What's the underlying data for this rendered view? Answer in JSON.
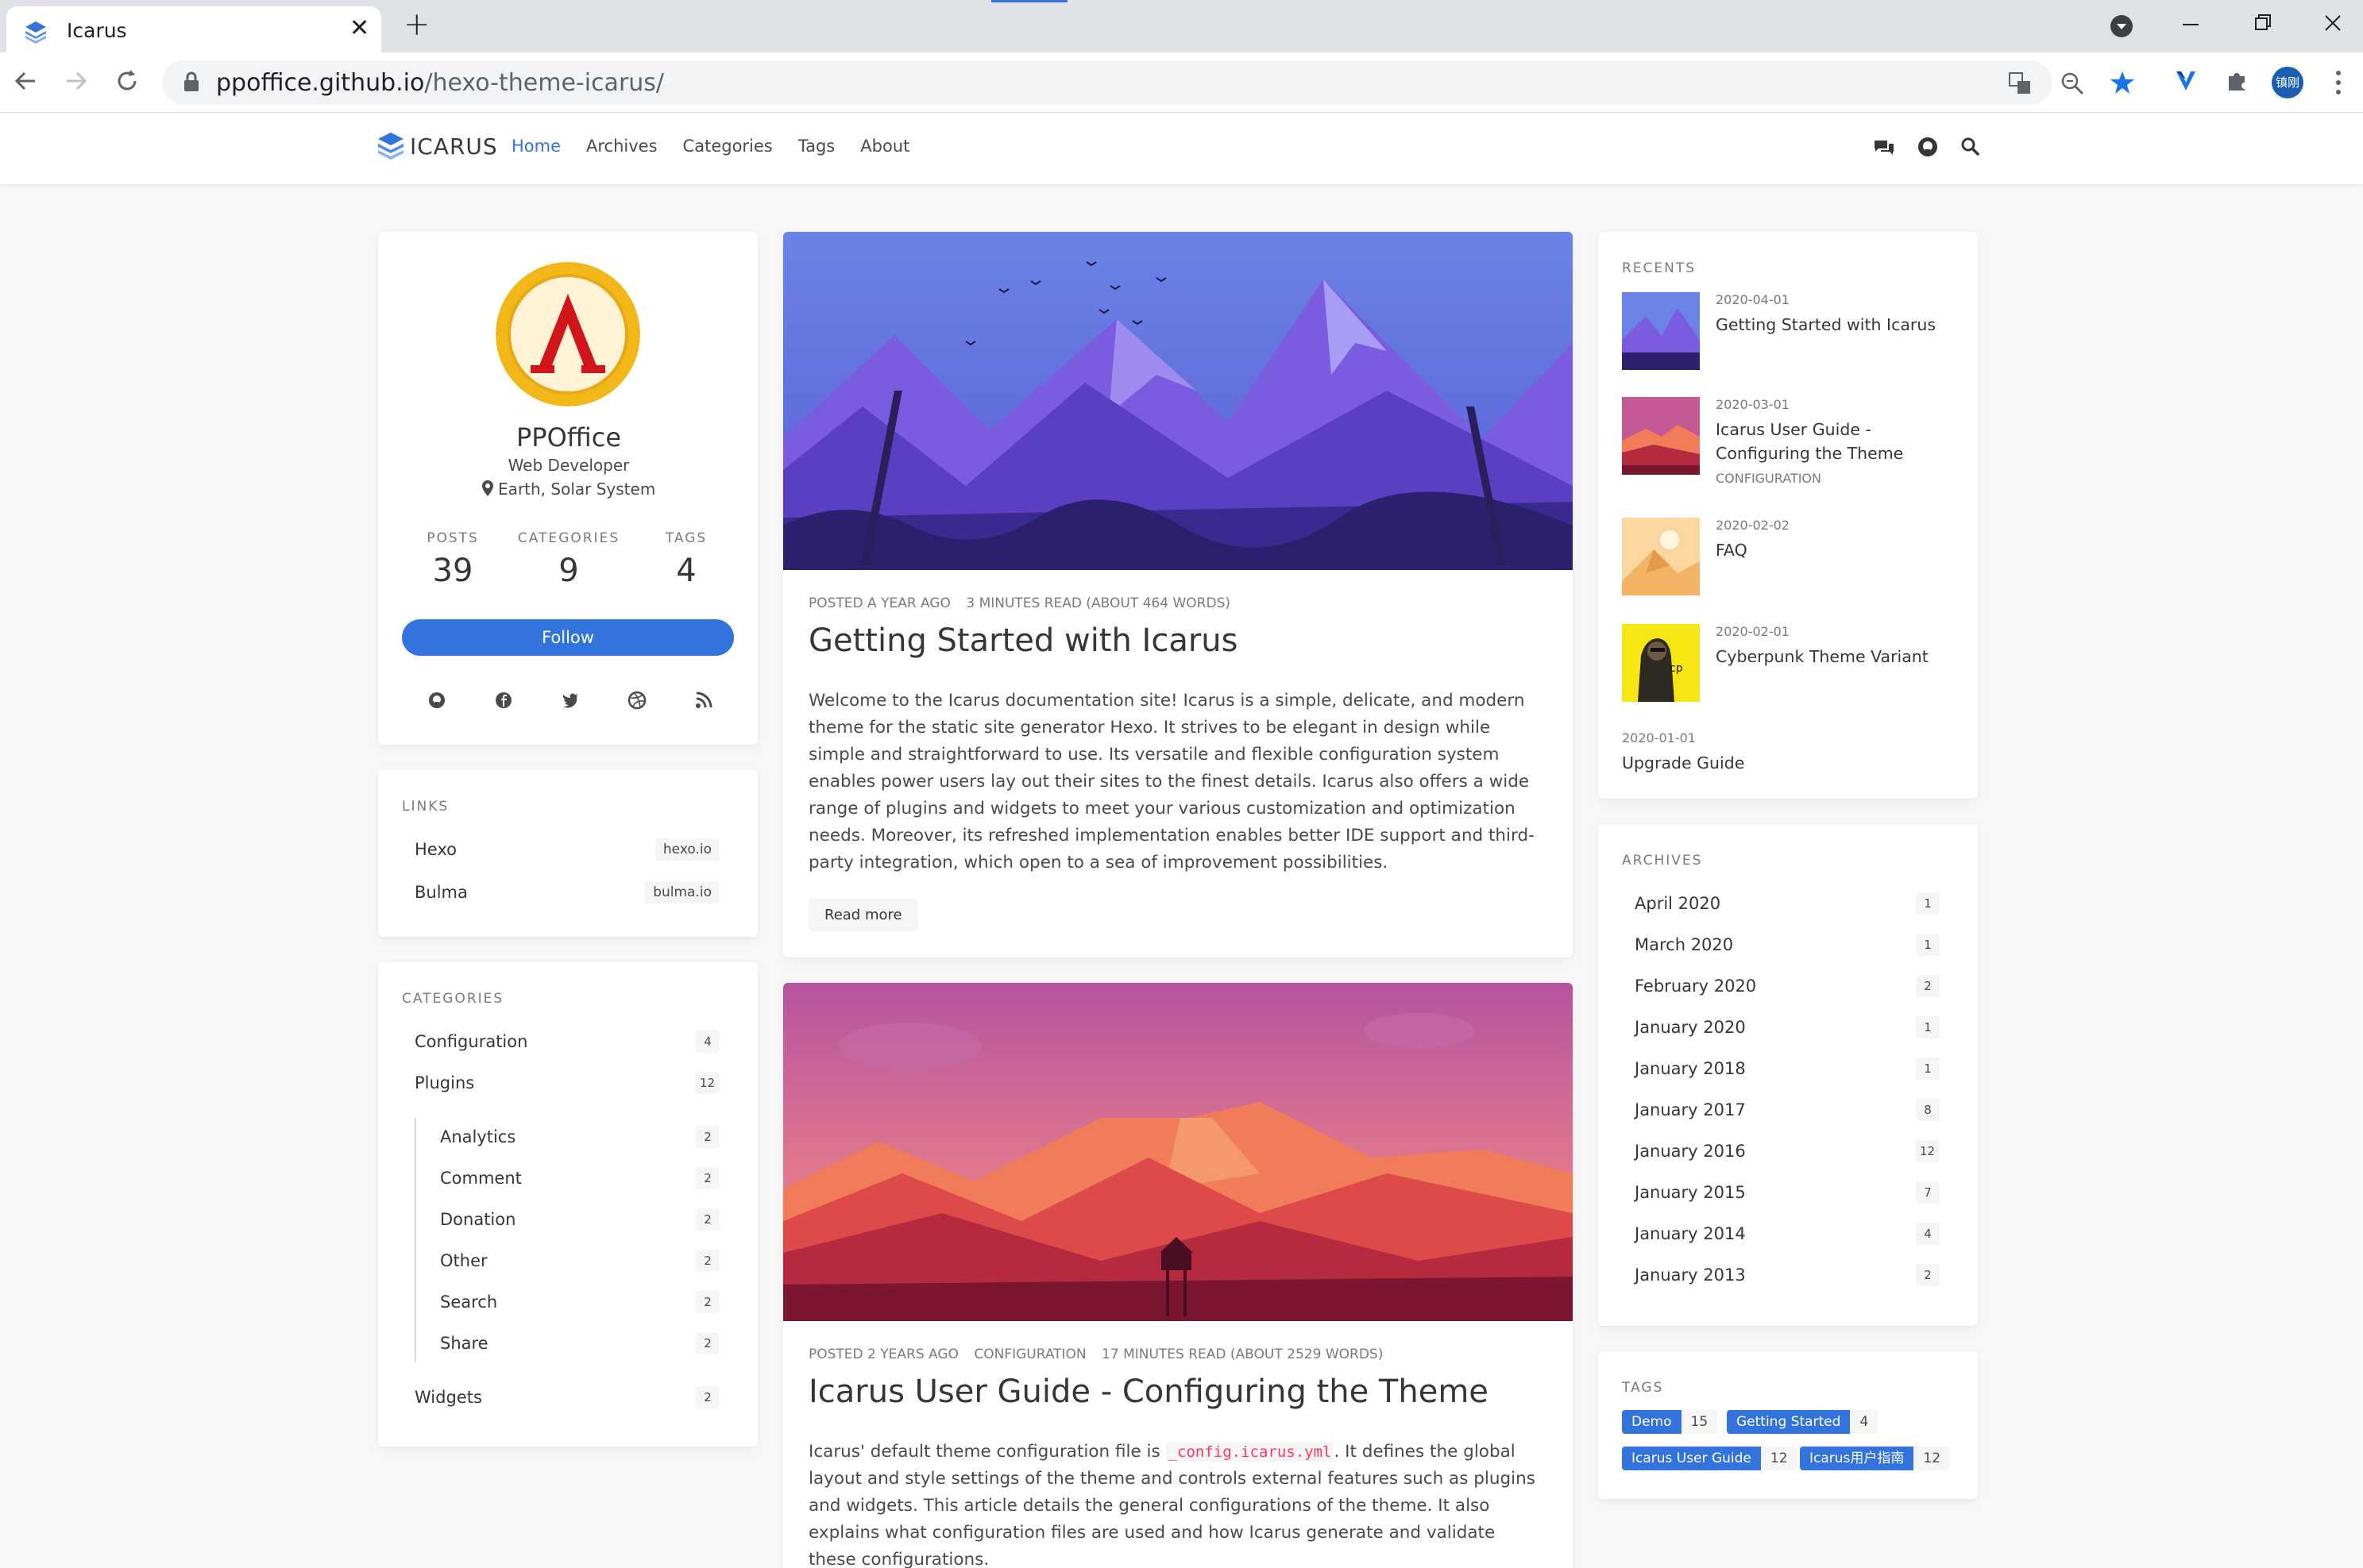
{
  "browser": {
    "tab_title": "Icarus",
    "close_glyph": "✕",
    "newtab_glyph": "+",
    "url_host": "ppoffice.github.io",
    "url_path": "/hexo-theme-icarus/",
    "profile_badge": "镇刚"
  },
  "nav": {
    "logo_text": "ICARUS",
    "items": [
      "Home",
      "Archives",
      "Categories",
      "Tags",
      "About"
    ]
  },
  "profile": {
    "name": "PPOffice",
    "role": "Web Developer",
    "location": "Earth, Solar System",
    "stats": [
      {
        "label": "POSTS",
        "value": "39"
      },
      {
        "label": "CATEGORIES",
        "value": "9"
      },
      {
        "label": "TAGS",
        "value": "4"
      }
    ],
    "follow_label": "Follow",
    "social_icons": [
      "github-icon",
      "facebook-icon",
      "twitter-icon",
      "dribbble-icon",
      "rss-icon"
    ]
  },
  "links": {
    "heading": "LINKS",
    "items": [
      {
        "name": "Hexo",
        "url": "hexo.io"
      },
      {
        "name": "Bulma",
        "url": "bulma.io"
      }
    ]
  },
  "categories": {
    "heading": "CATEGORIES",
    "items": [
      {
        "name": "Configuration",
        "count": "4"
      },
      {
        "name": "Plugins",
        "count": "12"
      },
      {
        "name": "Analytics",
        "count": "2"
      },
      {
        "name": "Comment",
        "count": "2"
      },
      {
        "name": "Donation",
        "count": "2"
      },
      {
        "name": "Other",
        "count": "2"
      },
      {
        "name": "Search",
        "count": "2"
      },
      {
        "name": "Share",
        "count": "2"
      },
      {
        "name": "Widgets",
        "count": "2"
      }
    ]
  },
  "posts": [
    {
      "meta": [
        "POSTED A YEAR AGO",
        "3 MINUTES READ (ABOUT 464 WORDS)"
      ],
      "title": "Getting Started with Icarus",
      "body": "Welcome to the Icarus documentation site! Icarus is a simple, delicate, and modern theme for the static site generator Hexo. It strives to be elegant in design while simple and straightforward to use. Its versatile and flexible configuration system enables power users lay out their sites to the finest details. Icarus also offers a wide range of plugins and widgets to meet your various customization and optimization needs. Moreover, its refreshed implementation enables better IDE support and third-party integration, which open to a sea of improvement possibilities.",
      "read_more": "Read more"
    },
    {
      "meta": [
        "POSTED 2 YEARS AGO",
        "CONFIGURATION",
        "17 MINUTES READ (ABOUT 2529 WORDS)"
      ],
      "title": "Icarus User Guide - Configuring the Theme",
      "body_pre": "Icarus' default theme configuration file is ",
      "body_code": "_config.icarus.yml",
      "body_post": ". It defines the global layout and style settings of the theme and controls external features such as plugins and widgets. This article details the general configurations of the theme. It also explains what configuration files are used and how Icarus generate and validate these configurations."
    }
  ],
  "recents": {
    "heading": "RECENTS",
    "items": [
      {
        "date": "2020-04-01",
        "title": "Getting Started with Icarus",
        "category": ""
      },
      {
        "date": "2020-03-01",
        "title": "Icarus User Guide - Configuring the Theme",
        "category": "CONFIGURATION"
      },
      {
        "date": "2020-02-02",
        "title": "FAQ",
        "category": ""
      },
      {
        "date": "2020-02-01",
        "title": "Cyberpunk Theme Variant",
        "category": ""
      },
      {
        "date": "2020-01-01",
        "title": "Upgrade Guide",
        "category": ""
      }
    ]
  },
  "archives": {
    "heading": "ARCHIVES",
    "items": [
      {
        "name": "April 2020",
        "count": "1"
      },
      {
        "name": "March 2020",
        "count": "1"
      },
      {
        "name": "February 2020",
        "count": "2"
      },
      {
        "name": "January 2020",
        "count": "1"
      },
      {
        "name": "January 2018",
        "count": "1"
      },
      {
        "name": "January 2017",
        "count": "8"
      },
      {
        "name": "January 2016",
        "count": "12"
      },
      {
        "name": "January 2015",
        "count": "7"
      },
      {
        "name": "January 2014",
        "count": "4"
      },
      {
        "name": "January 2013",
        "count": "2"
      }
    ]
  },
  "tags": {
    "heading": "TAGS",
    "items": [
      {
        "name": "Demo",
        "count": "15"
      },
      {
        "name": "Getting Started",
        "count": "4"
      },
      {
        "name": "Icarus User Guide",
        "count": "12"
      },
      {
        "name": "Icarus用户指南",
        "count": "12"
      }
    ]
  },
  "colors": {
    "accent": "#3273dc",
    "background": "#f7f7f7"
  }
}
